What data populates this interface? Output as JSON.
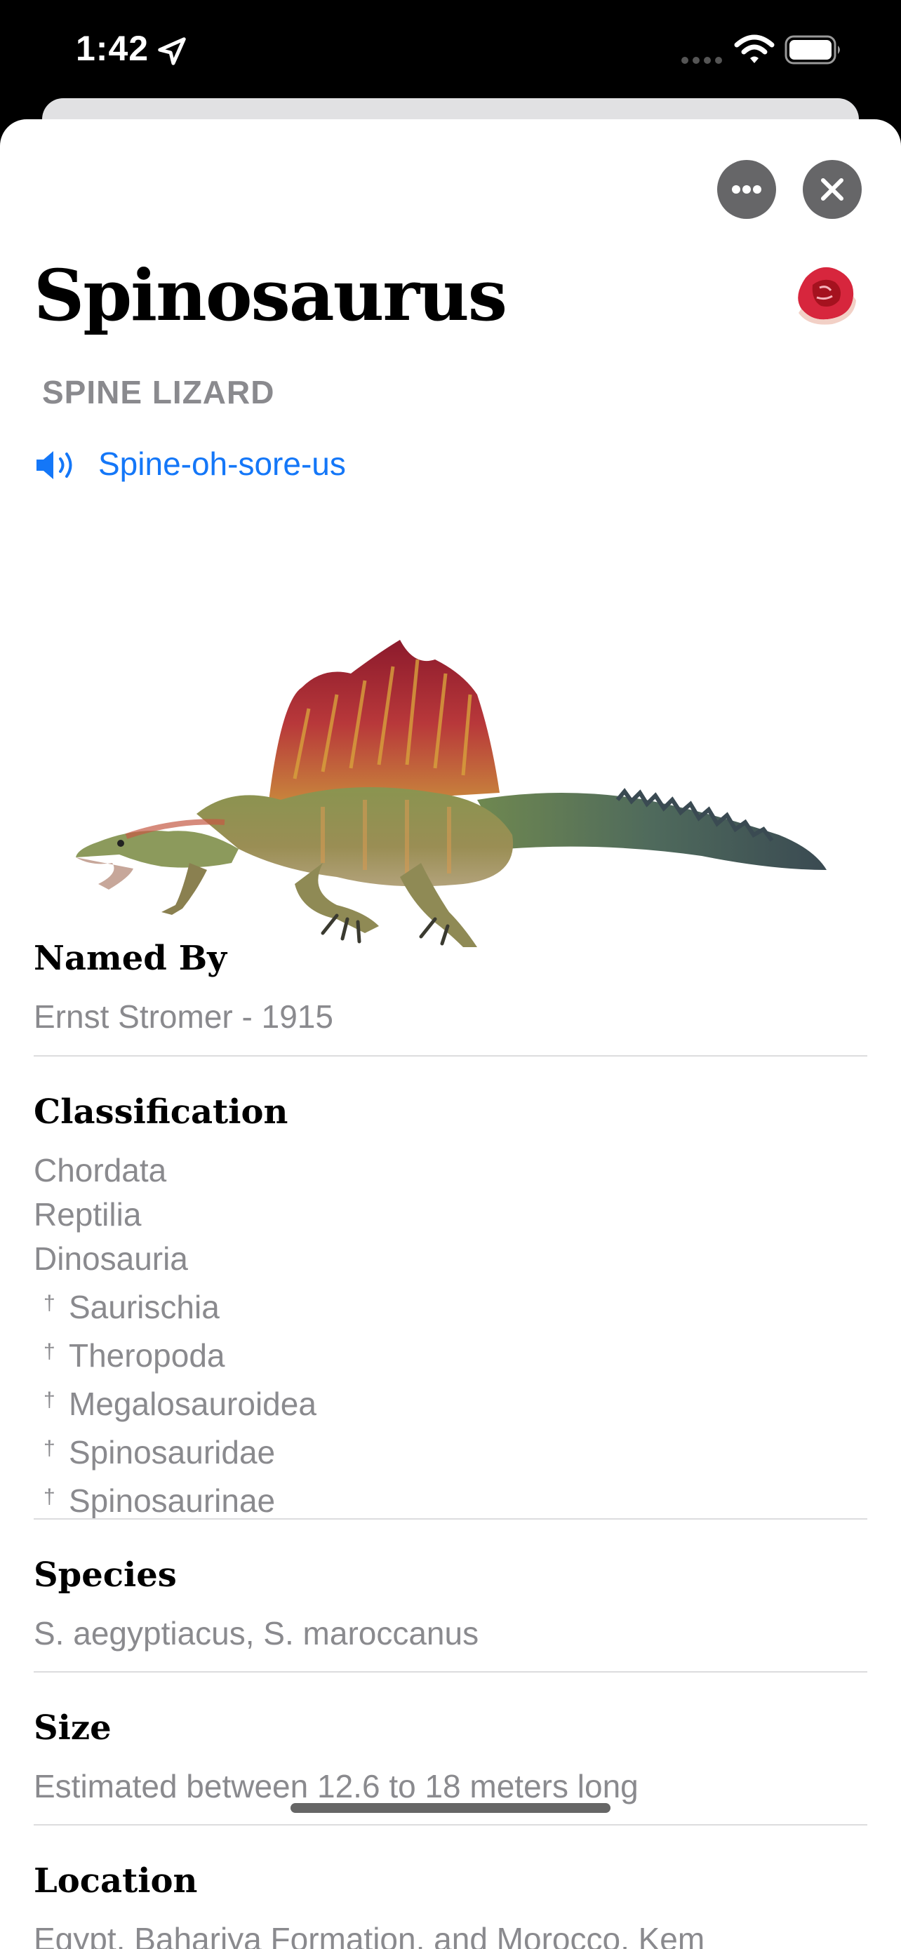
{
  "status_bar": {
    "time": "1:42"
  },
  "dinosaur": {
    "name": "Spinosaurus",
    "meaning": "SPINE LIZARD",
    "pronunciation": "Spine-oh-sore-us",
    "diet_icon": "meat-steak-icon"
  },
  "sections": {
    "named_by": {
      "heading": "Named By",
      "value": "Ernst Stromer - 1915"
    },
    "classification": {
      "heading": "Classification",
      "ranks": [
        "Chordata",
        "Reptilia",
        "Dinosauria"
      ],
      "clades": [
        "Saurischia",
        "Theropoda",
        "Megalosauroidea",
        "Spinosauridae",
        "Spinosaurinae"
      ],
      "clade_marker": "†"
    },
    "species": {
      "heading": "Species",
      "value": "S. aegyptiacus, S. maroccanus"
    },
    "size": {
      "heading": "Size",
      "value": "Estimated between 12.6 to 18 meters long"
    },
    "location": {
      "heading": "Location",
      "value": "Egypt, Bahariya Formation, and Morocco, Kem"
    }
  },
  "colors": {
    "accent": "#1477f8",
    "secondary_text": "#8a8a8e",
    "button_bg": "#666668"
  }
}
